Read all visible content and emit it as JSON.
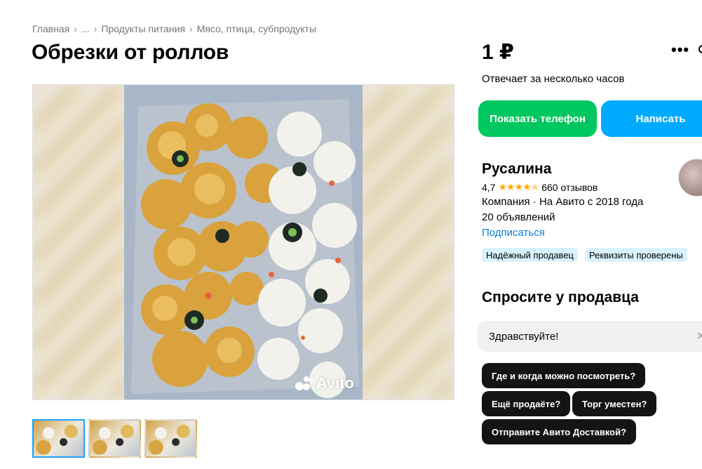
{
  "breadcrumbs": [
    "Главная",
    "...",
    "Продукты питания",
    "Мясо, птица, субпродукты"
  ],
  "listing": {
    "title": "Обрезки от роллов",
    "watermark": "Avito",
    "thumbnail_count": 3
  },
  "sidebar": {
    "price": "1 ₽",
    "response_time": "Отвечает за несколько часов",
    "show_phone_label": "Показать телефон",
    "write_label": "Написать",
    "more_icon": "more-dots-icon"
  },
  "seller": {
    "name": "Русалина",
    "rating": "4,7",
    "rating_value": 4.7,
    "reviews": "660 отзывов",
    "info": "Компания · На Авито с 2018 года",
    "ads": "20 объявлений",
    "subscribe_label": "Подписаться",
    "badges": [
      "Надёжный продавец",
      "Реквизиты проверены"
    ]
  },
  "ask": {
    "title": "Спросите у продавца",
    "message_value": "Здравствуйте!",
    "quick_questions": [
      "Где и когда можно посмотреть?",
      "Ещё продаёте?",
      "Торг уместен?",
      "Отправите Авито Доставкой?"
    ]
  },
  "colors": {
    "green_button": "#00c75f",
    "blue_button": "#00aaff",
    "link": "#0a7fd9",
    "star": "#ffa800",
    "badge_bg": "#d9f2ff"
  }
}
